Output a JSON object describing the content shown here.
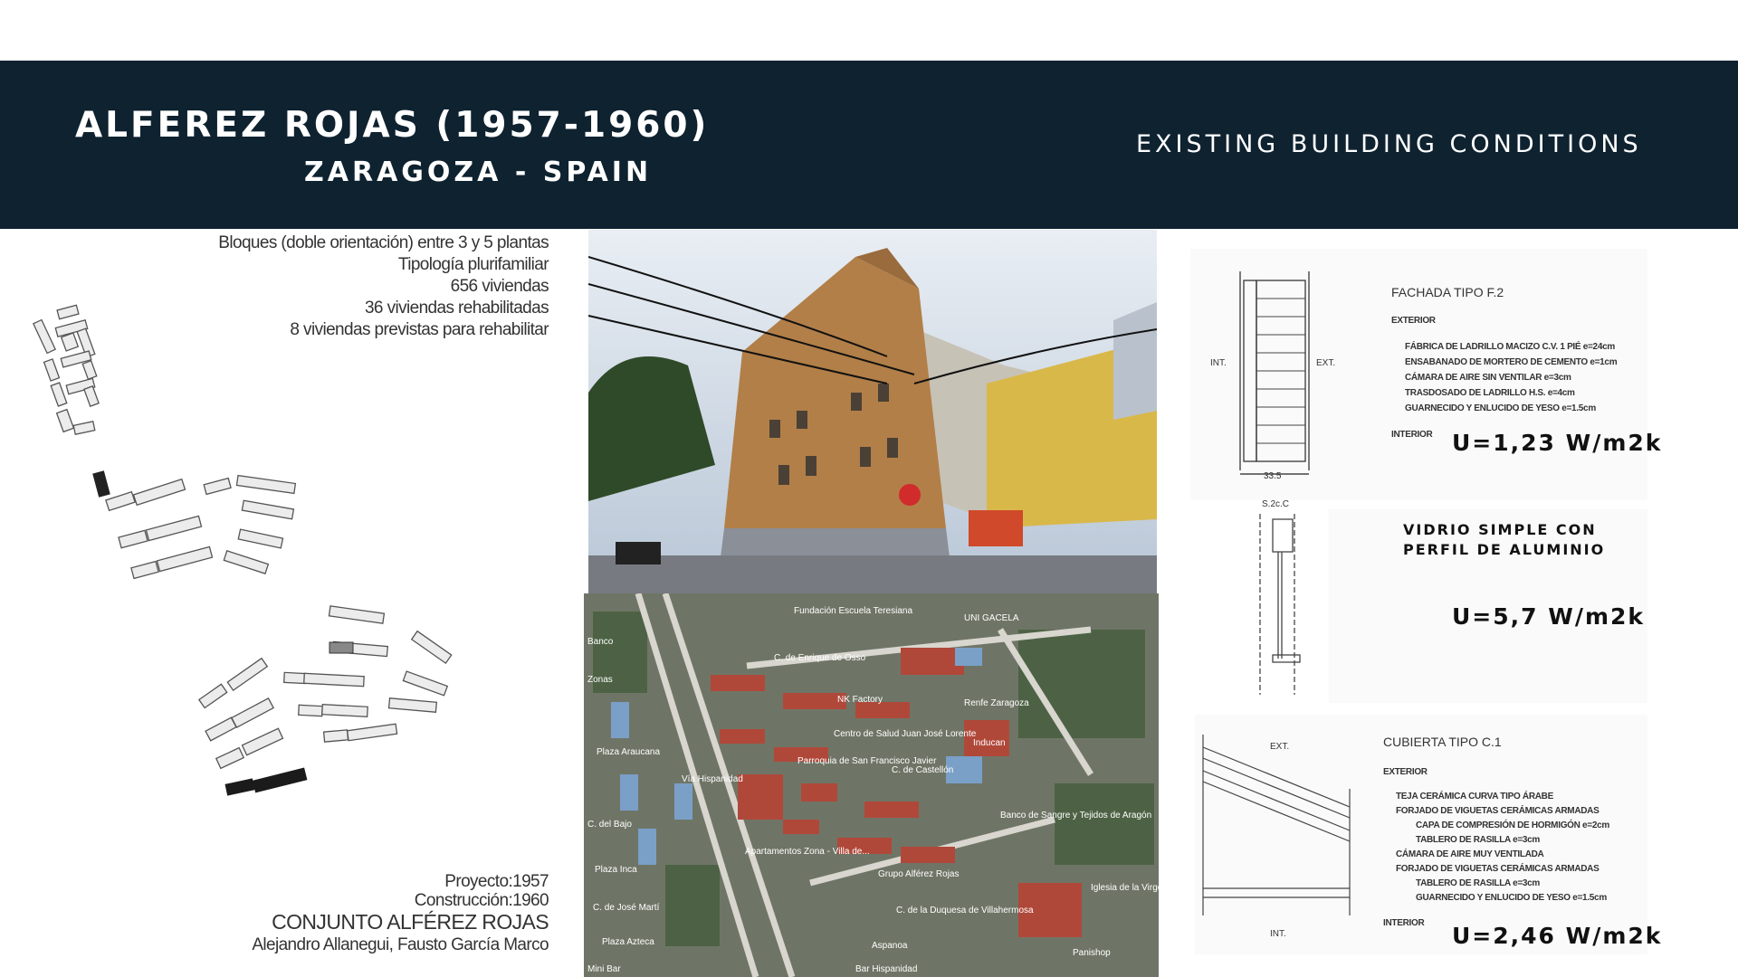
{
  "header": {
    "title": "ALFEREZ ROJAS (1957-1960)",
    "subtitle": "ZARAGOZA - SPAIN",
    "section": "EXISTING BUILDING CONDITIONS"
  },
  "summary": [
    "Bloques (doble orientación) entre 3 y 5 plantas",
    "Tipología plurifamiliar",
    "656 viviendas",
    "36 viviendas rehabilitadas",
    "8 viviendas previstas para rehabilitar"
  ],
  "credits": {
    "proyecto": "Proyecto:1957",
    "construccion": "Construcción:1960",
    "name": "CONJUNTO ALFÉREZ ROJAS",
    "architects": "Alejandro Allanegui, Fausto García Marco"
  },
  "map_labels": [
    "Fundación Escuela Teresiana",
    "C. de Enrique de Osso",
    "UNI GACELA",
    "NK Factory",
    "Renfe Zaragoza",
    "Centro de Salud Juan José Lorente",
    "Parroquia de San Francisco Javier",
    "C. de Castellón",
    "Inducan",
    "Apartamentos Zona - Villa de...",
    "Banco de Sangre y Tejidos de Aragón",
    "Grupo Alférez Rojas",
    "C. de la Duquesa de Villahermosa",
    "Iglesia de la Virgen",
    "Vía Hispanidad",
    "Plaza Araucana",
    "Plaza Inca",
    "C. de José Martí",
    "Plaza Azteca",
    "Aspanoa",
    "Panishop",
    "Bar Hispanidad",
    "Mini Bar",
    "Banco",
    "Zonas",
    "C. del Bajo"
  ],
  "facade": {
    "title": "FACHADA TIPO F.2",
    "exterior": "EXTERIOR",
    "layers": [
      "FÁBRICA DE LADRILLO MACIZO C.V. 1 PIÉ e=24cm",
      "ENSABANADO DE MORTERO DE CEMENTO e=1cm",
      "CÁMARA DE AIRE SIN VENTILAR e=3cm",
      "TRASDOSADO DE LADRILLO H.S. e=4cm",
      "GUARNECIDO Y ENLUCIDO DE YESO e=1.5cm"
    ],
    "interior": "INTERIOR",
    "u_value": "U=1,23 W/m2k",
    "label_int": "INT.",
    "label_ext": "EXT.",
    "dimension": "33.5"
  },
  "window": {
    "ref": "S.2c.C",
    "line1": "VIDRIO SIMPLE CON",
    "line2": "PERFIL DE ALUMINIO",
    "u_value": "U=5,7 W/m2k"
  },
  "roof": {
    "title": "CUBIERTA TIPO C.1",
    "exterior": "EXTERIOR",
    "layers": [
      "TEJA CERÁMICA CURVA TIPO ÁRABE",
      "FORJADO DE VIGUETAS CERÁMICAS ARMADAS",
      "CAPA DE COMPRESIÓN DE HORMIGÓN e=2cm",
      "TABLERO DE RASILLA e=3cm",
      "CÁMARA DE AIRE MUY VENTILADA",
      "FORJADO DE VIGUETAS CERÁMICAS ARMADAS",
      "TABLERO DE RASILLA e=3cm",
      "GUARNECIDO Y ENLUCIDO DE YESO e=1.5cm"
    ],
    "interior": "INTERIOR",
    "u_value": "U=2,46 W/m2k",
    "label_ext": "EXT.",
    "label_int": "INT."
  }
}
